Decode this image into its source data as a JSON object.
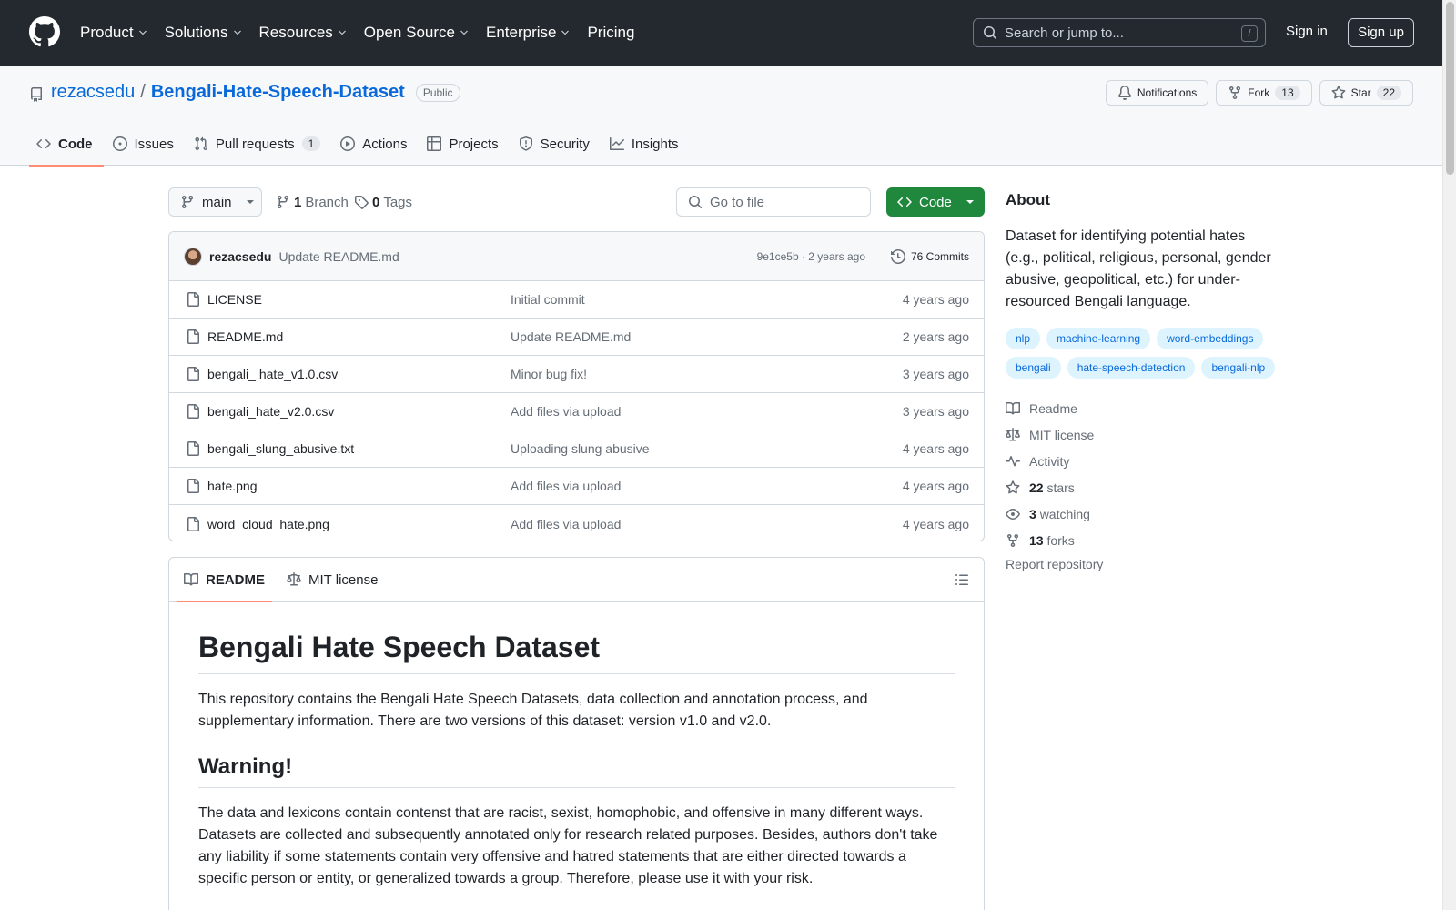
{
  "header": {
    "nav": [
      "Product",
      "Solutions",
      "Resources",
      "Open Source",
      "Enterprise",
      "Pricing"
    ],
    "search_placeholder": "Search or jump to...",
    "search_key": "/",
    "signin": "Sign in",
    "signup": "Sign up"
  },
  "repo": {
    "owner": "rezacsedu",
    "separator": "/",
    "name": "Bengali-Hate-Speech-Dataset",
    "visibility": "Public",
    "notifications": "Notifications",
    "fork_label": "Fork",
    "fork_count": "13",
    "star_label": "Star",
    "star_count": "22"
  },
  "tabs": {
    "code": "Code",
    "issues": "Issues",
    "pulls": "Pull requests",
    "pulls_count": "1",
    "actions": "Actions",
    "projects": "Projects",
    "security": "Security",
    "insights": "Insights"
  },
  "branchbar": {
    "branch": "main",
    "branch_count": "1",
    "branch_label": "Branch",
    "tag_count": "0",
    "tag_label": "Tags",
    "goto_file": "Go to file",
    "code_button": "Code"
  },
  "commit": {
    "author": "rezacsedu",
    "message": "Update README.md",
    "meta": "9e1ce5b · 2 years ago",
    "commits": "76 Commits"
  },
  "files": [
    {
      "name": "LICENSE",
      "message": "Initial commit",
      "time": "4 years ago"
    },
    {
      "name": "README.md",
      "message": "Update README.md",
      "time": "2 years ago"
    },
    {
      "name": "bengali_ hate_v1.0.csv",
      "message": "Minor bug fix!",
      "time": "3 years ago"
    },
    {
      "name": "bengali_hate_v2.0.csv",
      "message": "Add files via upload",
      "time": "3 years ago"
    },
    {
      "name": "bengali_slung_abusive.txt",
      "message": "Uploading slung abusive",
      "time": "4 years ago"
    },
    {
      "name": "hate.png",
      "message": "Add files via upload",
      "time": "4 years ago"
    },
    {
      "name": "word_cloud_hate.png",
      "message": "Add files via upload",
      "time": "4 years ago"
    }
  ],
  "readme": {
    "tab_readme": "README",
    "tab_license": "MIT license",
    "title": "Bengali Hate Speech Dataset",
    "intro": "This repository contains the Bengali Hate Speech Datasets, data collection and annotation process, and supplementary information. There are two versions of this dataset: version v1.0 and v2.0.",
    "warning_title": "Warning!",
    "warning_text": "The data and lexicons contain contenst that are racist, sexist, homophobic, and offensive in many different ways. Datasets are collected and subsequently annotated only for research related purposes. Besides, authors don't take any liability if some statements contain very offensive and hatred statements that are either directed towards a specific person or entity, or generalized towards a group. Therefore, please use it with your risk."
  },
  "about": {
    "title": "About",
    "description": "Dataset for identifying potential hates (e.g., political, religious, personal, gender abusive, geopolitical, etc.) for under-resourced Bengali language.",
    "topics": [
      "nlp",
      "machine-learning",
      "word-embeddings",
      "bengali",
      "hate-speech-detection",
      "bengali-nlp"
    ],
    "readme": "Readme",
    "license": "MIT license",
    "activity": "Activity",
    "stars_count": "22",
    "stars_label": "stars",
    "watching_count": "3",
    "watching_label": "watching",
    "forks_count": "13",
    "forks_label": "forks",
    "report": "Report repository"
  },
  "colors": {
    "header_bg": "#24292f",
    "link": "#0969da",
    "primary_button": "#1f883d",
    "tab_underline": "#fd8c73"
  }
}
